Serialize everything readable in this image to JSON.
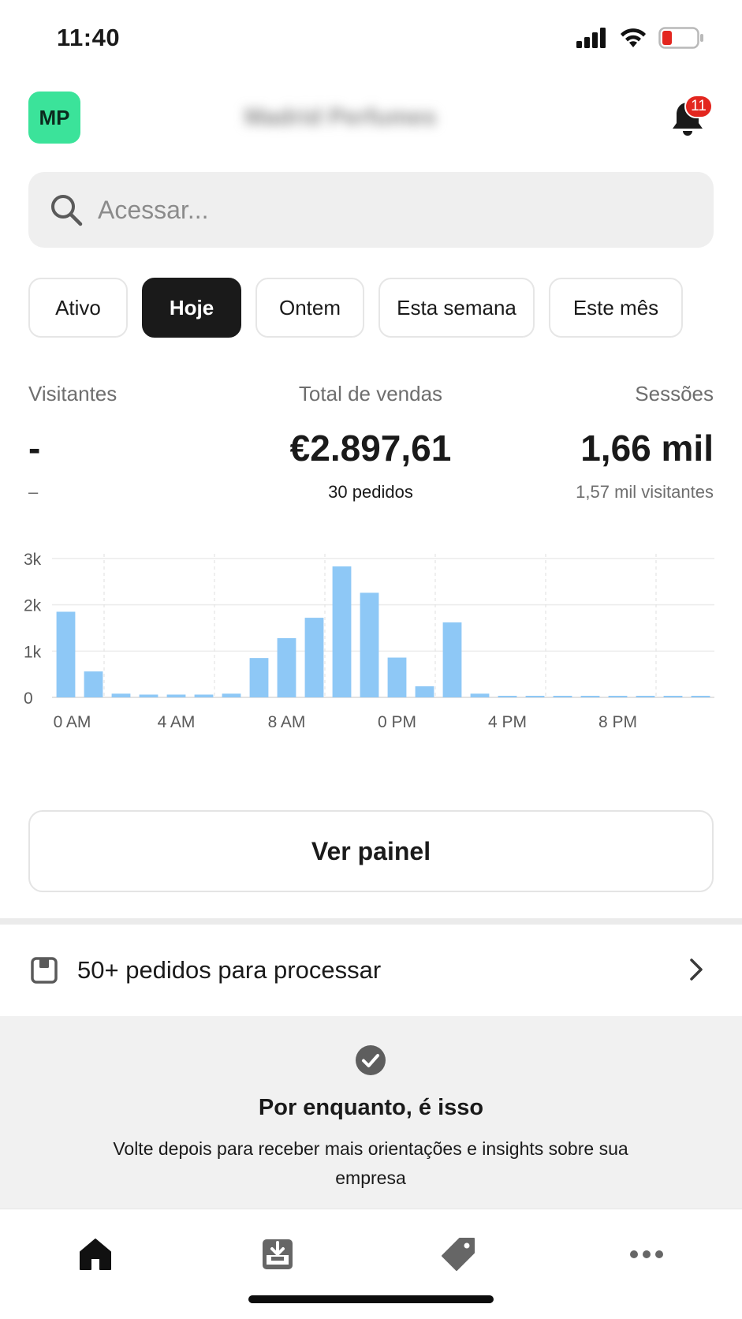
{
  "status_bar": {
    "time": "11:40"
  },
  "header": {
    "avatar_initials": "MP",
    "store_name": "Madrid Perfumes",
    "notification_count": "11"
  },
  "search": {
    "placeholder": "Acessar..."
  },
  "filters": [
    {
      "label": "Ativo",
      "active": false
    },
    {
      "label": "Hoje",
      "active": true
    },
    {
      "label": "Ontem",
      "active": false
    },
    {
      "label": "Esta semana",
      "active": false
    },
    {
      "label": "Este mês",
      "active": false
    }
  ],
  "metrics": {
    "visitors": {
      "label": "Visitantes",
      "value": "-",
      "sub": "–"
    },
    "sales": {
      "label": "Total de vendas",
      "value": "€2.897,61",
      "sub": "30 pedidos"
    },
    "sessions": {
      "label": "Sessões",
      "value": "1,66 mil",
      "sub": "1,57 mil visitantes"
    }
  },
  "chart_data": {
    "type": "bar",
    "categories": [
      "0",
      "1",
      "2",
      "3",
      "4",
      "5",
      "6",
      "7",
      "8",
      "9",
      "10",
      "11",
      "12",
      "13",
      "14",
      "15",
      "16",
      "17",
      "18",
      "19",
      "20",
      "21",
      "22",
      "23"
    ],
    "x_tick_labels": [
      "0 AM",
      "4 AM",
      "8 AM",
      "0 PM",
      "4 PM",
      "8 PM"
    ],
    "values": [
      1850,
      560,
      80,
      60,
      60,
      60,
      80,
      850,
      1280,
      1720,
      2830,
      2260,
      860,
      240,
      1620,
      80,
      10,
      10,
      10,
      10,
      10,
      10,
      10,
      10
    ],
    "y_ticks": [
      "0",
      "1k",
      "2k",
      "3k"
    ],
    "ylim": [
      0,
      3000
    ],
    "bar_color": "#8ec8f6",
    "grid": true
  },
  "dashboard_button": {
    "label": "Ver painel"
  },
  "orders": {
    "label": "50+ pedidos para processar"
  },
  "empty_state": {
    "title": "Por enquanto, é isso",
    "description": "Volte depois para receber mais orientações e insights sobre sua empresa"
  },
  "tabbar": {
    "items": [
      {
        "icon": "home-icon"
      },
      {
        "icon": "orders-inbox-icon"
      },
      {
        "icon": "tag-icon"
      },
      {
        "icon": "more-icon"
      }
    ]
  }
}
